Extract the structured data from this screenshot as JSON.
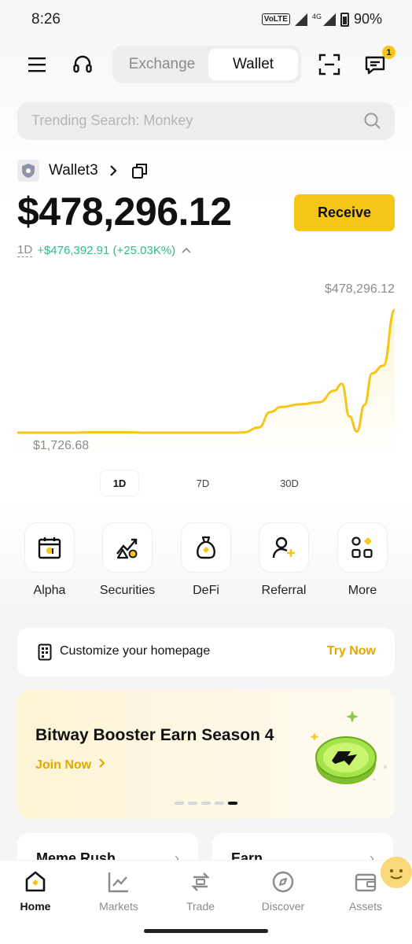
{
  "status_bar": {
    "time": "8:26",
    "volte": "VoLTE",
    "network": "4G",
    "battery": "90%"
  },
  "header": {
    "tabs": [
      {
        "label": "Exchange",
        "active": false
      },
      {
        "label": "Wallet",
        "active": true
      }
    ],
    "messages_badge": "1",
    "icons": [
      "menu-icon",
      "headset-icon",
      "scan-icon",
      "messages-icon"
    ]
  },
  "search": {
    "placeholder": "Trending Search: Monkey"
  },
  "wallet": {
    "name": "Wallet3",
    "balance": "$478,296.12",
    "receive_label": "Receive",
    "period": "1D",
    "change": "+$476,392.91 (+25.03K%)"
  },
  "chart": {
    "high_label": "$478,296.12",
    "low_label": "$1,726.68",
    "ranges": [
      {
        "label": "1D",
        "active": true
      },
      {
        "label": "7D",
        "active": false
      },
      {
        "label": "30D",
        "active": false
      }
    ],
    "accent_color": "#f5c518"
  },
  "chart_data": {
    "type": "area",
    "y_label_high": "$478,296.12",
    "y_label_low": "$1,726.68",
    "x_range": "1D",
    "points": [
      [
        0,
        1726.68
      ],
      [
        0.16,
        1726.68
      ],
      [
        0.18,
        2900
      ],
      [
        0.3,
        2900
      ],
      [
        0.33,
        1726.68
      ],
      [
        0.58,
        1726.68
      ],
      [
        0.6,
        2900
      ],
      [
        0.64,
        22000
      ],
      [
        0.67,
        82000
      ],
      [
        0.7,
        102000
      ],
      [
        0.75,
        112000
      ],
      [
        0.8,
        120000
      ],
      [
        0.84,
        165000
      ],
      [
        0.86,
        192000
      ],
      [
        0.88,
        65000
      ],
      [
        0.9,
        6000
      ],
      [
        0.92,
        110000
      ],
      [
        0.94,
        232000
      ],
      [
        0.97,
        262000
      ],
      [
        1.0,
        478296.12
      ]
    ]
  },
  "quick_actions": [
    {
      "label": "Alpha",
      "icon": "alpha-calendar-icon"
    },
    {
      "label": "Securities",
      "icon": "securities-chart-icon"
    },
    {
      "label": "DeFi",
      "icon": "defi-bag-icon"
    },
    {
      "label": "Referral",
      "icon": "referral-user-plus-icon"
    },
    {
      "label": "More",
      "icon": "more-grid-icon"
    }
  ],
  "customize": {
    "label": "Customize your homepage",
    "action": "Try Now"
  },
  "banner": {
    "title": "Bitway Booster Earn Season 4",
    "cta": "Join Now",
    "page_count": 5,
    "active_page": 5
  },
  "cards": [
    {
      "title": "Meme Rush"
    },
    {
      "title": "Earn"
    }
  ],
  "bottom_nav": [
    {
      "label": "Home",
      "active": true
    },
    {
      "label": "Markets",
      "active": false
    },
    {
      "label": "Trade",
      "active": false
    },
    {
      "label": "Discover",
      "active": false
    },
    {
      "label": "Assets",
      "active": false
    }
  ],
  "colors": {
    "accent": "#f5c518",
    "positive": "#2ebd85",
    "link": "#e0a800"
  }
}
